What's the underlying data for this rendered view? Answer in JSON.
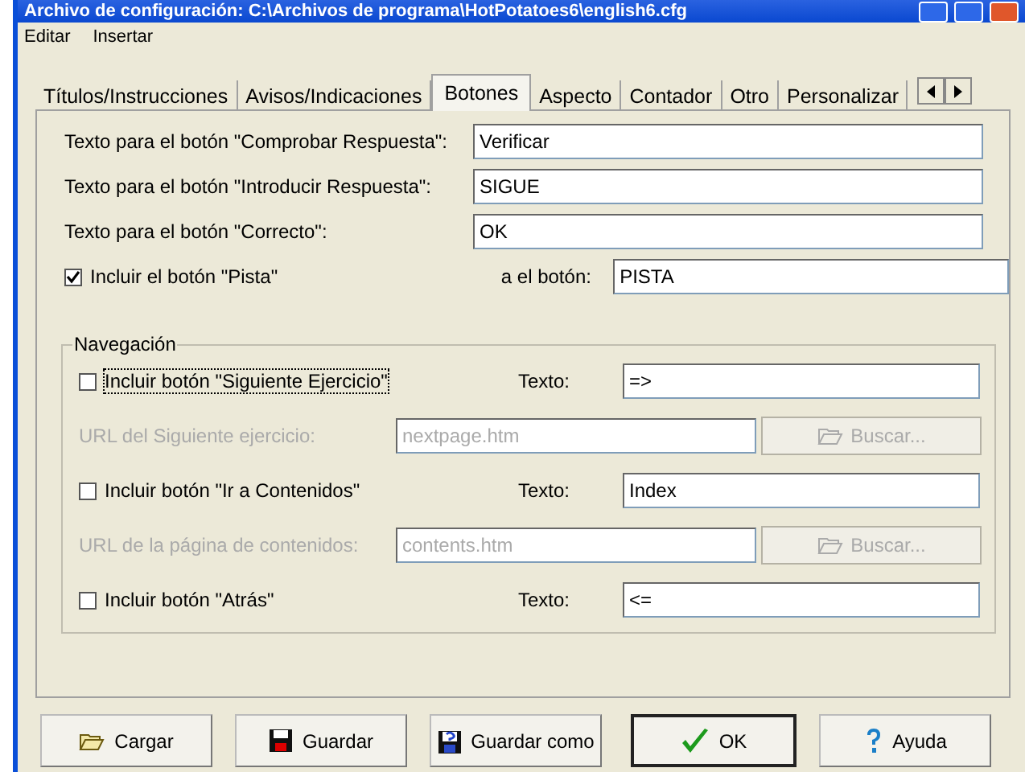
{
  "window": {
    "title": "Archivo de configuración: C:\\Archivos de programa\\HotPotatoes6\\english6.cfg"
  },
  "menu": [
    {
      "label": "Editar"
    },
    {
      "label": "Insertar"
    }
  ],
  "tabs": [
    {
      "label": "Títulos/Instrucciones",
      "selected": false
    },
    {
      "label": "Avisos/Indicaciones",
      "selected": false
    },
    {
      "label": "Botones",
      "selected": true
    },
    {
      "label": "Aspecto",
      "selected": false
    },
    {
      "label": "Contador",
      "selected": false
    },
    {
      "label": "Otro",
      "selected": false
    },
    {
      "label": "Personalizar",
      "selected": false
    }
  ],
  "button_texts": [
    {
      "label": "Texto para el botón \"Comprobar Respuesta\":",
      "value": "Verificar"
    },
    {
      "label": "Texto para el botón \"Introducir Respuesta\":",
      "value": "SIGUE"
    },
    {
      "label": "Texto para el botón \"Correcto\":",
      "value": "OK"
    }
  ],
  "hint": {
    "label": "Incluir el botón \"Pista\"",
    "checked": true,
    "field_label": "a el botón:",
    "value": "PISTA"
  },
  "navigation": {
    "title": "Navegación",
    "items": [
      {
        "kind": "toggle",
        "label": "Incluir botón \"Siguiente Ejercicio\"",
        "checked": false,
        "focused": true,
        "field_label": "Texto:",
        "value": "=>"
      },
      {
        "kind": "url",
        "label": "URL del Siguiente ejercicio:",
        "value": "nextpage.htm",
        "disabled": true,
        "button": "Buscar..."
      },
      {
        "kind": "toggle",
        "label": "Incluir botón \"Ir a Contenidos\"",
        "checked": false,
        "focused": false,
        "field_label": "Texto:",
        "value": "Index"
      },
      {
        "kind": "url",
        "label": "URL de la página de contenidos:",
        "value": "contents.htm",
        "disabled": true,
        "button": "Buscar..."
      },
      {
        "kind": "toggle",
        "label": "Incluir botón \"Atrás\"",
        "checked": false,
        "focused": false,
        "field_label": "Texto:",
        "value": "<="
      }
    ]
  },
  "footer_buttons": [
    {
      "label": "Cargar",
      "kind": "load",
      "default": false
    },
    {
      "label": "Guardar",
      "kind": "save",
      "default": false
    },
    {
      "label": "Guardar como",
      "kind": "saveas",
      "default": false
    },
    {
      "label": "OK",
      "kind": "confirm",
      "default": true
    },
    {
      "label": "Ayuda",
      "kind": "help",
      "default": false
    }
  ]
}
